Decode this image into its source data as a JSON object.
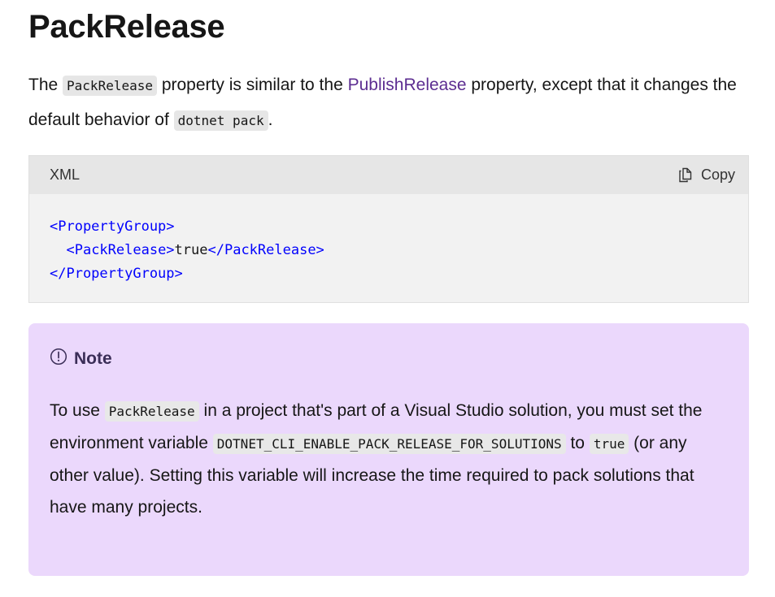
{
  "heading": "PackRelease",
  "intro": {
    "t1": "The ",
    "code1": "PackRelease",
    "t2": " property is similar to the ",
    "link": "PublishRelease",
    "t3": " property, except that it changes the default behavior of ",
    "code2": "dotnet pack",
    "t4": "."
  },
  "codeblock": {
    "language": "XML",
    "copy_label": "Copy",
    "lines": {
      "l1_open": "<PropertyGroup>",
      "l2_indent": "  ",
      "l2_open": "<PackRelease>",
      "l2_value": "true",
      "l2_close": "</PackRelease>",
      "l3_close": "</PropertyGroup>"
    }
  },
  "note": {
    "title": "Note",
    "icon": "info-circle-icon",
    "t1": "To use ",
    "code1": "PackRelease",
    "t2": " in a project that's part of a Visual Studio solution, you must set the environment variable ",
    "code2": "DOTNET_CLI_ENABLE_PACK_RELEASE_FOR_SOLUTIONS",
    "t3": " to ",
    "code3": "true",
    "t4": " (or any other value). Setting this variable will increase the time required to pack solutions that have many projects."
  },
  "colors": {
    "link": "#5c2d91",
    "xml_tag": "#0101fd",
    "note_bg": "#ebd8fc",
    "note_title": "#3b2e58"
  }
}
